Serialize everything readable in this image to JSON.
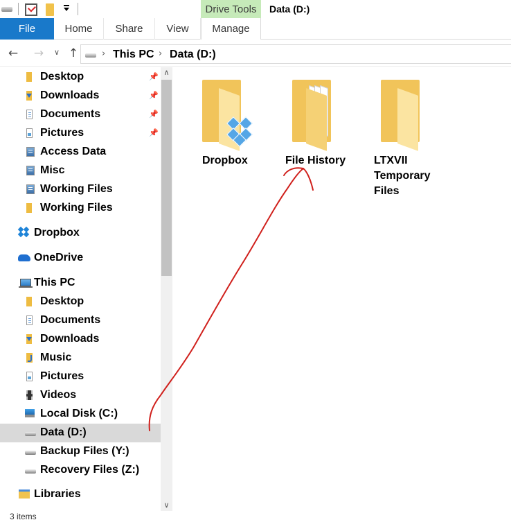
{
  "titlebar": {
    "context_tab_header": "Drive Tools",
    "window_title": "Data (D:)"
  },
  "ribbon": {
    "tabs": [
      {
        "label": "File"
      },
      {
        "label": "Home"
      },
      {
        "label": "Share"
      },
      {
        "label": "View"
      },
      {
        "label": "Manage"
      }
    ]
  },
  "address": {
    "breadcrumbs": [
      "This PC",
      "Data (D:)"
    ]
  },
  "nav_pane": {
    "quick_access": [
      {
        "label": "Desktop",
        "icon": "desktop-folder-icon",
        "pinned": true
      },
      {
        "label": "Downloads",
        "icon": "downloads-folder-icon",
        "pinned": true
      },
      {
        "label": "Documents",
        "icon": "documents-folder-icon",
        "pinned": true
      },
      {
        "label": "Pictures",
        "icon": "pictures-folder-icon",
        "pinned": true
      },
      {
        "label": "Access Data",
        "icon": "network-folder-icon"
      },
      {
        "label": "Misc",
        "icon": "network-folder-icon"
      },
      {
        "label": "Working Files",
        "icon": "network-folder-icon"
      },
      {
        "label": "Working Files",
        "icon": "folder-icon"
      }
    ],
    "dropbox": "Dropbox",
    "onedrive": "OneDrive",
    "this_pc": "This PC",
    "this_pc_items": [
      {
        "label": "Desktop",
        "icon": "desktop-folder-icon"
      },
      {
        "label": "Documents",
        "icon": "documents-folder-icon"
      },
      {
        "label": "Downloads",
        "icon": "downloads-folder-icon"
      },
      {
        "label": "Music",
        "icon": "music-folder-icon"
      },
      {
        "label": "Pictures",
        "icon": "pictures-folder-icon"
      },
      {
        "label": "Videos",
        "icon": "videos-folder-icon"
      },
      {
        "label": "Local Disk (C:)",
        "icon": "windows-drive-icon"
      },
      {
        "label": "Data (D:)",
        "icon": "drive-icon",
        "selected": true
      },
      {
        "label": "Backup Files (Y:)",
        "icon": "drive-icon"
      },
      {
        "label": "Recovery Files (Z:)",
        "icon": "drive-icon"
      }
    ],
    "libraries": "Libraries"
  },
  "content": {
    "items": [
      {
        "label": "Dropbox",
        "icon": "dropbox-folder-icon"
      },
      {
        "label": "File History",
        "icon": "folder-icon"
      },
      {
        "label_lines": [
          "LTXVII",
          "Temporary",
          "Files"
        ],
        "icon": "folder-icon"
      }
    ]
  },
  "status": {
    "item_count": "3 items"
  },
  "colors": {
    "accent": "#1979ca",
    "context_tab": "#c6eab9",
    "selection": "#d9d9d9",
    "folder": "#f1c45a",
    "annotation": "#d0201c"
  }
}
